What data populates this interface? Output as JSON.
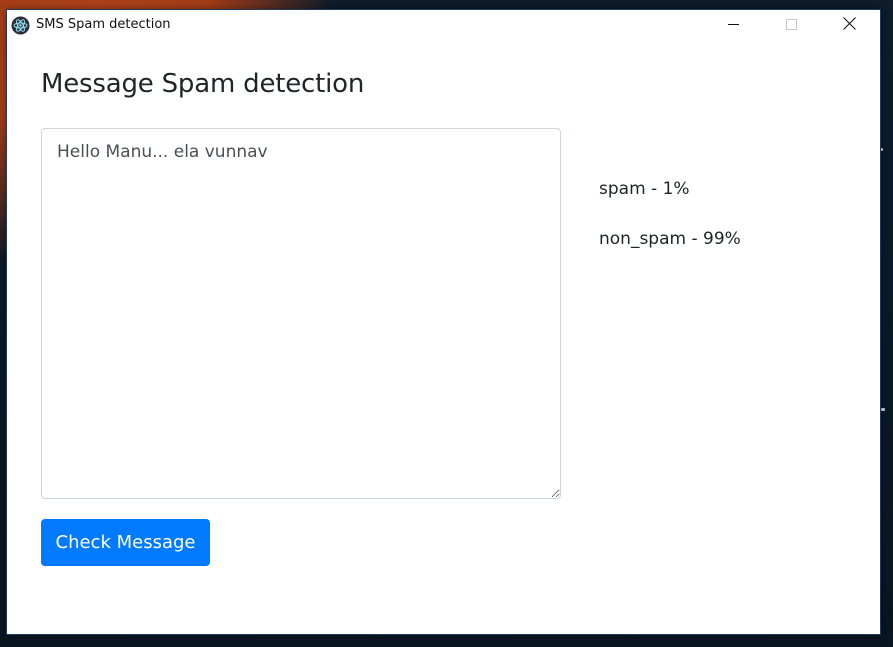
{
  "window": {
    "title": "SMS Spam detection",
    "controls": {
      "minimize": "minimize-icon",
      "maximize": "maximize-icon",
      "close": "close-icon"
    }
  },
  "page": {
    "heading": "Message Spam detection"
  },
  "message": {
    "value": "Hello Manu... ela vunnav"
  },
  "results": {
    "spam": "spam - 1%",
    "non_spam": "non_spam - 99%"
  },
  "actions": {
    "check_label": "Check Message"
  },
  "colors": {
    "accent": "#007bff",
    "text": "#212529",
    "input_border": "#ced4da"
  }
}
